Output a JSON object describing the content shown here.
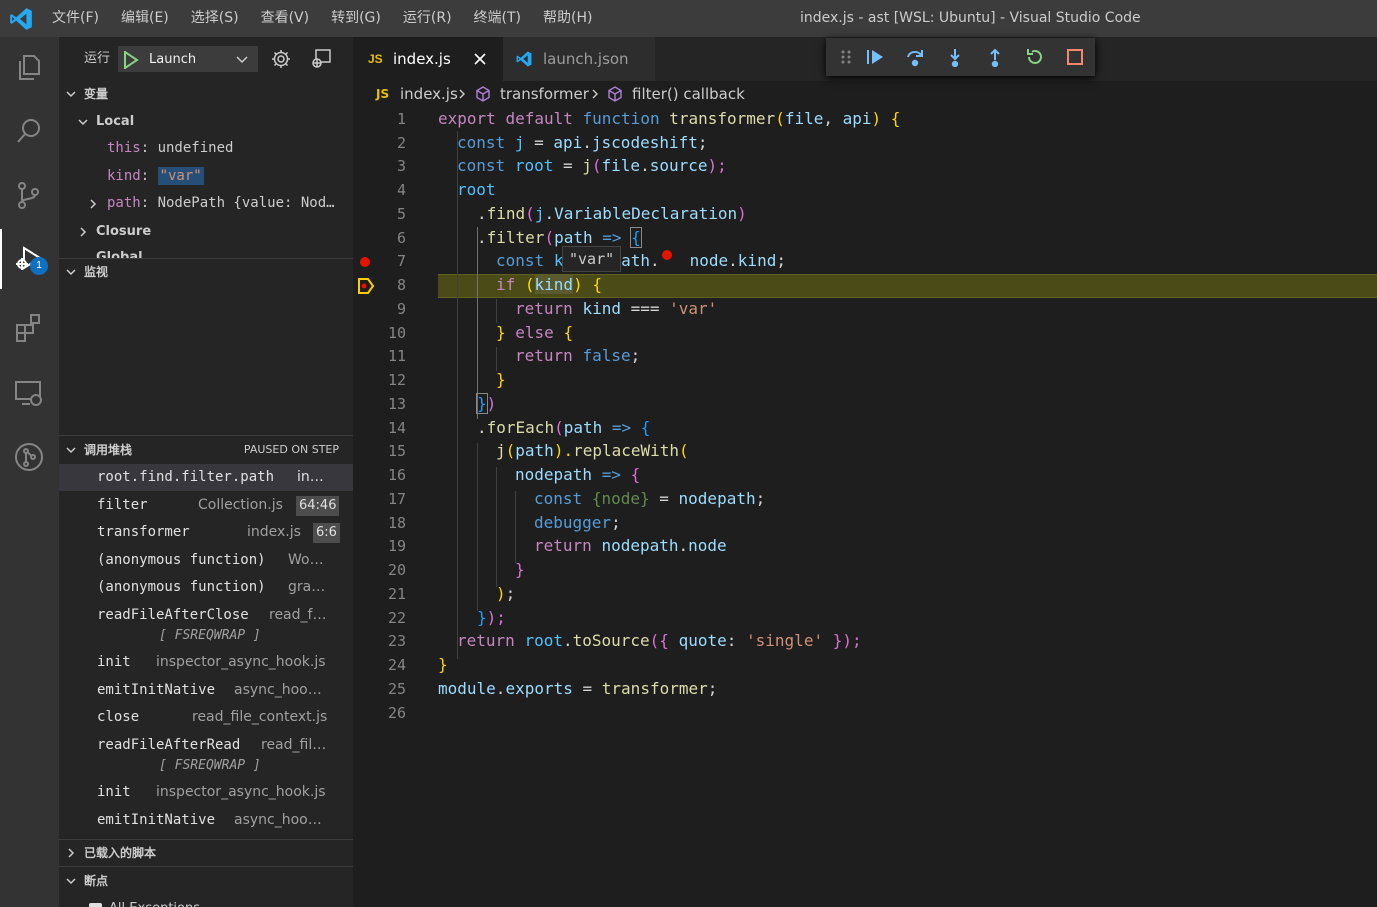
{
  "titlebar": {
    "menus": [
      "文件(F)",
      "编辑(E)",
      "选择(S)",
      "查看(V)",
      "转到(G)",
      "运行(R)",
      "终端(T)",
      "帮助(H)"
    ],
    "title": "index.js - ast [WSL: Ubuntu] - Visual Studio Code"
  },
  "activitybar": {
    "items": [
      "files-icon",
      "search-icon",
      "source-control-icon",
      "run-debug-icon",
      "extensions-icon",
      "remote-explorer-icon",
      "git-graph-icon"
    ],
    "debug_badge": "1",
    "accent": "#0e70c0"
  },
  "sidebar": {
    "run_label": "运行",
    "launch_config": "Launch",
    "variables_header": "变量",
    "local_label": "Local",
    "variables": [
      {
        "name": "this",
        "value": "undefined"
      },
      {
        "name": "kind",
        "value": "\"var\""
      },
      {
        "name": "path",
        "value": "NodePath {value: Nod…"
      }
    ],
    "closure_label": "Closure",
    "global_label": "Global",
    "watch_header": "监视",
    "callstack_header": "调用堆栈",
    "callstack_status": "PAUSED ON STEP",
    "frames": [
      {
        "fn": "root.find.filter.path",
        "file": "in…",
        "line": ""
      },
      {
        "fn": "filter",
        "file": "Collection.js",
        "line": "64:46"
      },
      {
        "fn": "transformer",
        "file": "index.js",
        "line": "6:6"
      },
      {
        "fn": "(anonymous function)",
        "file": "Wo…",
        "line": ""
      },
      {
        "fn": "(anonymous function)",
        "file": "gra…",
        "line": ""
      },
      {
        "fn": "readFileAfterClose",
        "file": "read_f…",
        "line": ""
      },
      {
        "label": "[ FSREQWRAP ]"
      },
      {
        "fn": "init",
        "file": "inspector_async_hook.js",
        "line": ""
      },
      {
        "fn": "emitInitNative",
        "file": "async_hoo…",
        "line": ""
      },
      {
        "fn": "close",
        "file": "read_file_context.js",
        "line": ""
      },
      {
        "fn": "readFileAfterRead",
        "file": "read_fil…",
        "line": ""
      },
      {
        "label": "[ FSREQWRAP ]"
      },
      {
        "fn": "init",
        "file": "inspector_async_hook.js",
        "line": ""
      },
      {
        "fn": "emitInitNative",
        "file": "async_hoo…",
        "line": ""
      }
    ],
    "loaded_scripts_header": "已载入的脚本",
    "breakpoints_header": "断点",
    "breakpoint_item": "All Exceptions"
  },
  "editor": {
    "tabs": [
      {
        "icon": "JS",
        "label": "index.js",
        "active": true
      },
      {
        "icon": "vscode-icon",
        "label": "launch.json",
        "active": false
      }
    ],
    "breadcrumbs": [
      "index.js",
      "transformer",
      "filter() callback"
    ],
    "hover_value": "\"var\"",
    "current_line": 8,
    "breakpoint_line": 7,
    "line_numbers": [
      "1",
      "2",
      "3",
      "4",
      "5",
      "6",
      "7",
      "8",
      "9",
      "10",
      "11",
      "12",
      "13",
      "14",
      "15",
      "16",
      "17",
      "18",
      "19",
      "20",
      "21",
      "22",
      "23",
      "24",
      "25",
      "26"
    ],
    "code": {
      "l1": [
        "export",
        " ",
        "default",
        " ",
        "function",
        " ",
        "transformer",
        "(",
        "file",
        ", ",
        "api",
        ") ",
        "{"
      ],
      "l2": [
        "const",
        " ",
        "j",
        " = ",
        "api",
        ".",
        "jscodeshift",
        ";"
      ],
      "l3": [
        "const",
        " ",
        "root",
        " = ",
        "j",
        "(",
        "file",
        ".",
        "source",
        ");"
      ],
      "l4": [
        "root"
      ],
      "l5": [
        ".",
        "find",
        "(",
        "j",
        ".",
        "VariableDeclaration",
        ")"
      ],
      "l6": [
        ".",
        "filter",
        "(",
        "path",
        " => ",
        "{"
      ],
      "l7": [
        "const",
        " ",
        "k",
        "path",
        ".",
        "node",
        ".",
        "kind",
        ";"
      ],
      "l8": [
        "if",
        " (",
        "kind",
        ") ",
        "{"
      ],
      "l9": [
        "return",
        " ",
        "kind",
        " === ",
        "'var'"
      ],
      "l10": [
        "}",
        " ",
        "else",
        " ",
        "{"
      ],
      "l11": [
        "return",
        " ",
        "false",
        ";"
      ],
      "l12": [
        "}"
      ],
      "l13": [
        "}",
        ")"
      ],
      "l14": [
        ".",
        "forEach",
        "(",
        "path",
        " => ",
        "{"
      ],
      "l15": [
        "j",
        "(",
        "path",
        ").",
        "replaceWith",
        "("
      ],
      "l16": [
        "nodepath",
        " => ",
        "{"
      ],
      "l17": [
        "const",
        " ",
        "{",
        "node",
        "}",
        " = ",
        "nodepath",
        ";"
      ],
      "l18": [
        "debugger",
        ";"
      ],
      "l19": [
        "return",
        " ",
        "nodepath",
        ".",
        "node"
      ],
      "l20": [
        "}"
      ],
      "l21": [
        ")",
        ";"
      ],
      "l22": [
        "}",
        ");"
      ],
      "l23": [
        "return",
        " ",
        "root",
        ".",
        "toSource",
        "({ ",
        "quote",
        ": ",
        "'single'",
        " });"
      ],
      "l24": [
        "}"
      ],
      "l25": [
        "module",
        ".",
        "exports",
        " = ",
        "transformer",
        ";"
      ]
    }
  },
  "debug_toolbar": {
    "buttons": [
      "drag-grip-icon",
      "continue-icon",
      "step-over-icon",
      "step-into-icon",
      "step-out-icon",
      "restart-icon",
      "stop-icon"
    ]
  }
}
